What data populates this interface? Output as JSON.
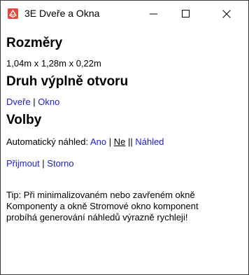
{
  "window": {
    "title": "3E Dveře a Okna",
    "controls": {
      "minimize": "minimize-icon",
      "maximize": "maximize-icon",
      "close": "close-icon"
    }
  },
  "sections": {
    "dimensions": {
      "heading": "Rozměry",
      "value": "1,04m x 1,28m x 0,22m"
    },
    "fill_type": {
      "heading": "Druh výplně otvoru",
      "door": "Dveře",
      "window": "Okno",
      "separator": " | "
    },
    "options": {
      "heading": "Volby",
      "auto_preview_label": "Automatický náhled:",
      "yes": "Ano",
      "no": "Ne",
      "separator": " | ",
      "double_separator": " || ",
      "preview": "Náhled"
    },
    "actions": {
      "accept": "Přijmout",
      "cancel": "Storno",
      "separator": " | "
    },
    "tip": "Tip: Při minimalizovaném nebo zavřeném okně Komponenty a okně Stromové okno komponent probíhá generování náhledů výrazně rychleji!"
  },
  "colors": {
    "link": "#2020d0",
    "app_icon": "#e8453c"
  }
}
